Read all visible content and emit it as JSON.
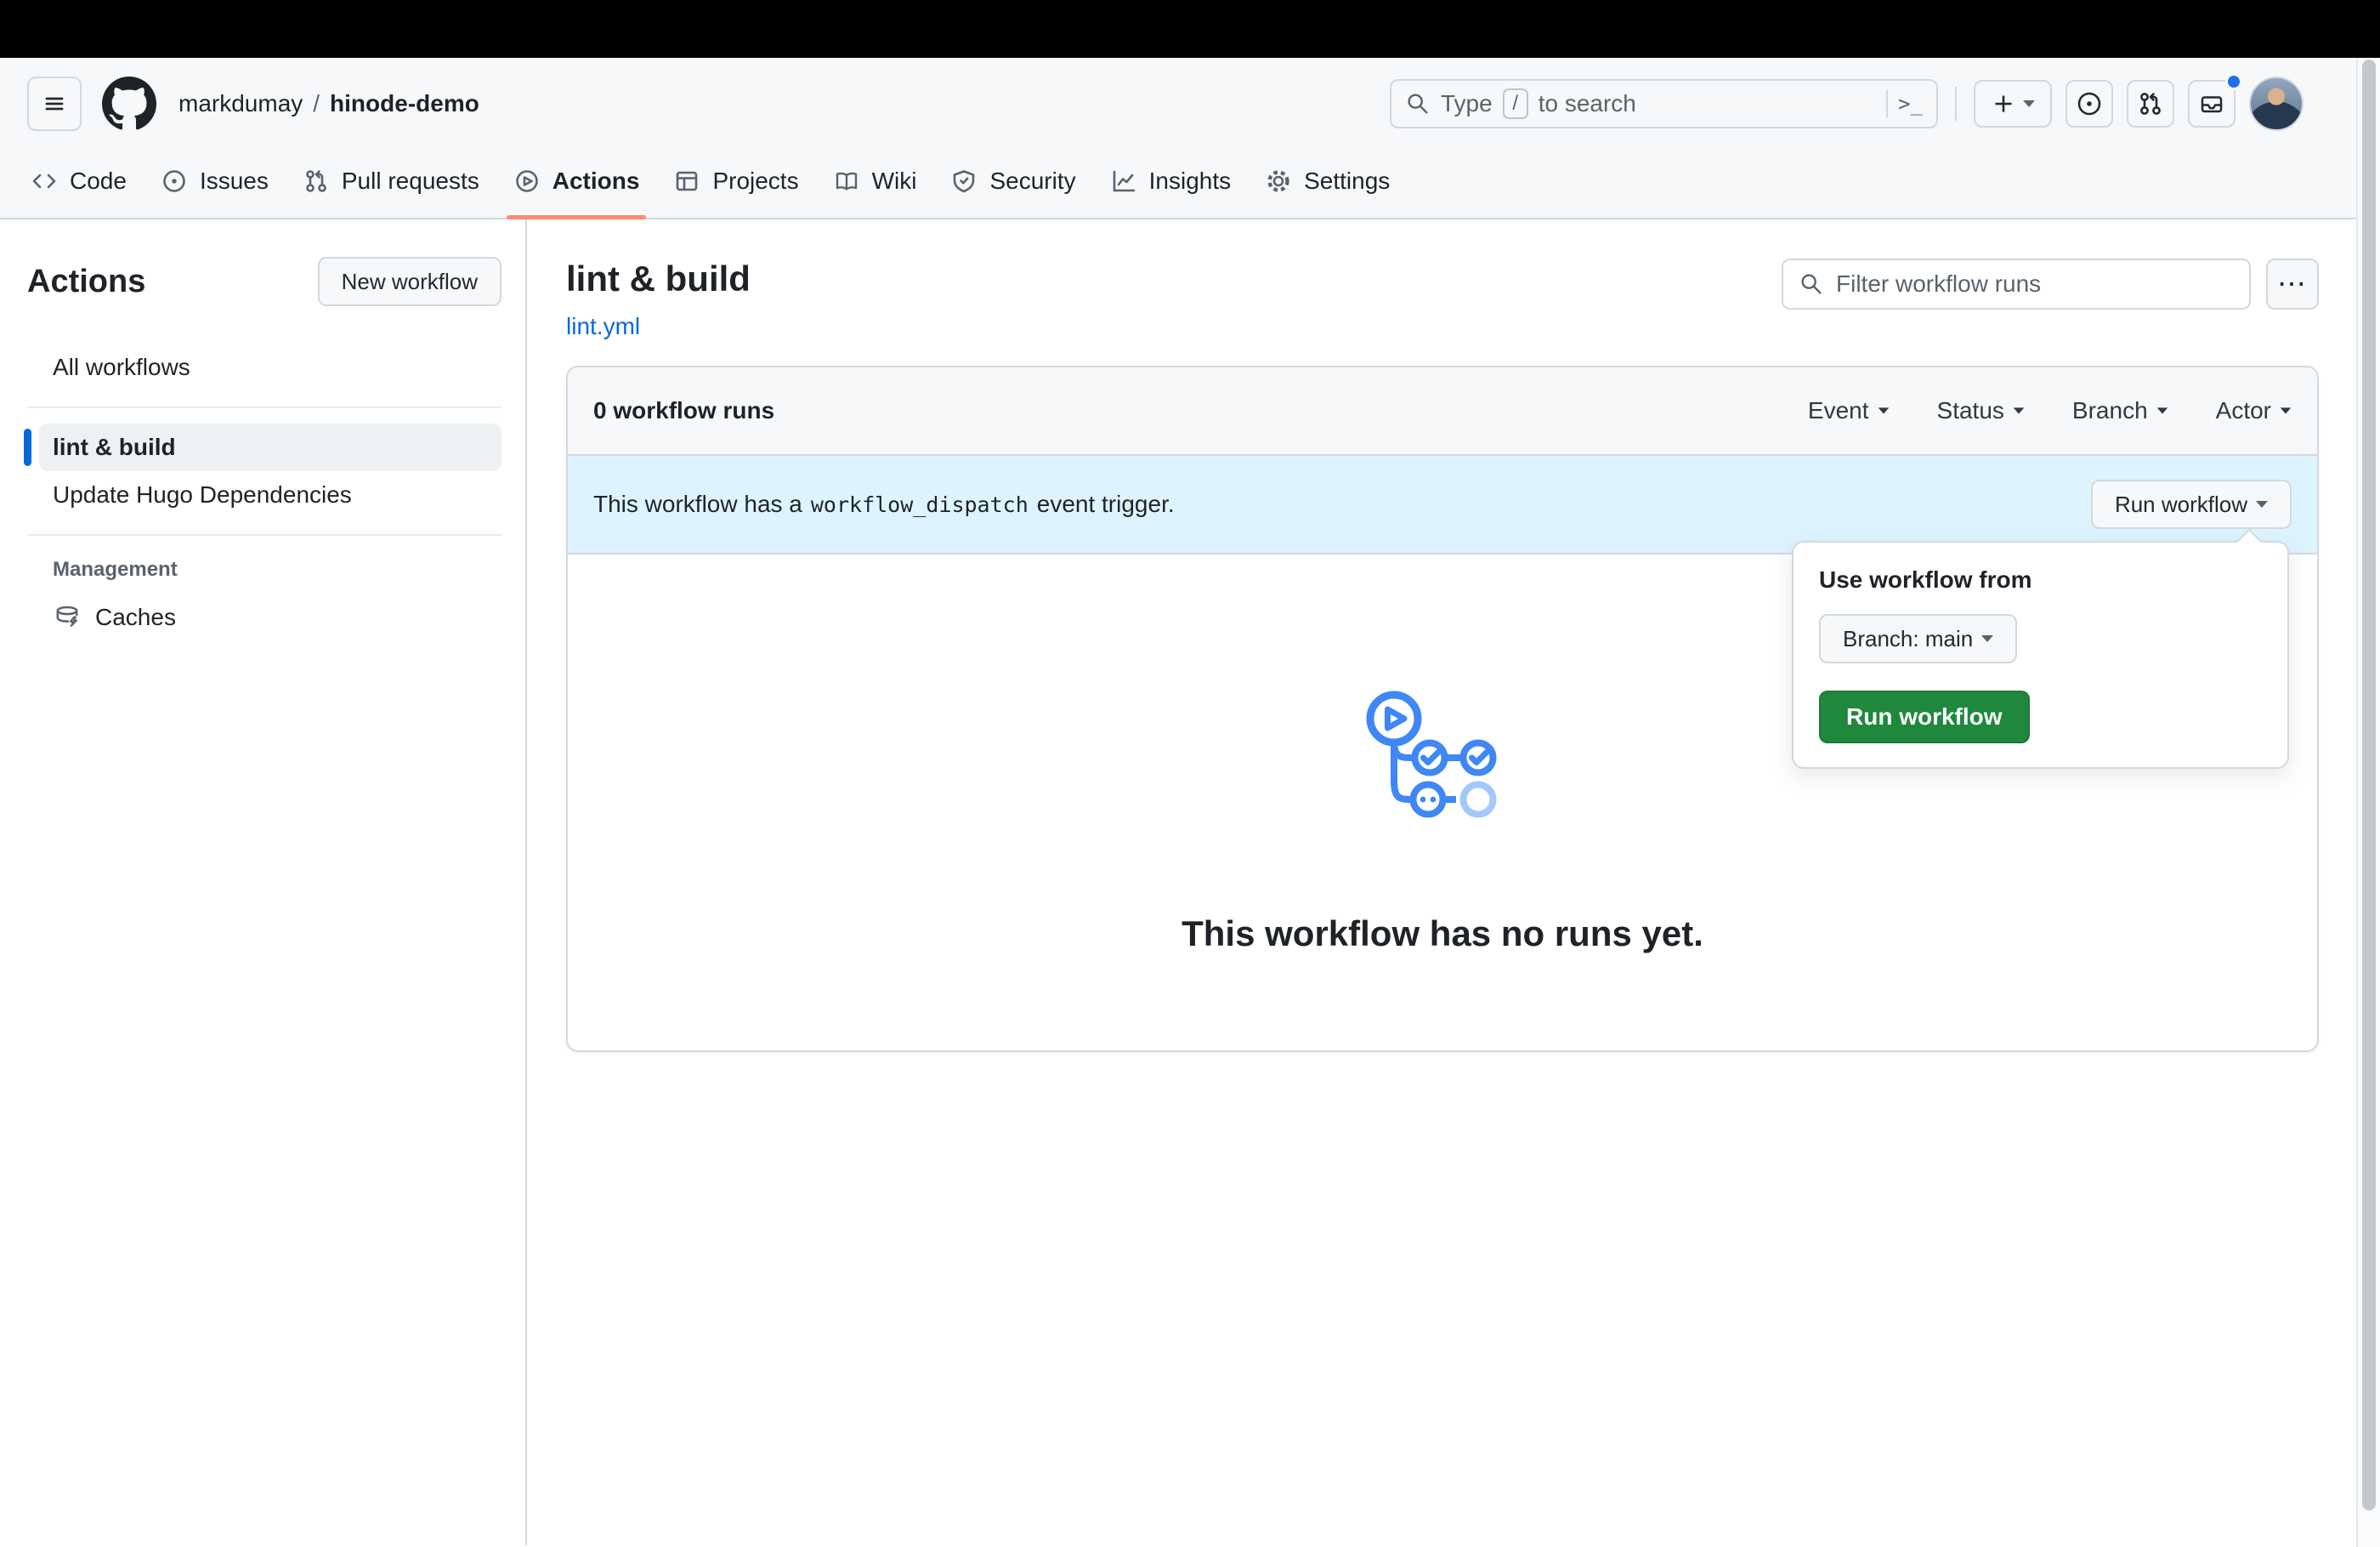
{
  "header": {
    "breadcrumb": {
      "owner": "markdumay",
      "separator": "/",
      "repo": "hinode-demo"
    },
    "search": {
      "prefix": "Type",
      "slash_key": "/",
      "suffix": "to search",
      "command_palette_glyph": ">_"
    },
    "notification_dot_color": "#1f6feb"
  },
  "nav": {
    "active_underline_color": "#fd8c73",
    "tabs": [
      {
        "label": "Code",
        "icon": "code-icon",
        "active": false
      },
      {
        "label": "Issues",
        "icon": "issue-opened-icon",
        "active": false
      },
      {
        "label": "Pull requests",
        "icon": "git-pull-request-icon",
        "active": false
      },
      {
        "label": "Actions",
        "icon": "play-circle-icon",
        "active": true
      },
      {
        "label": "Projects",
        "icon": "table-icon",
        "active": false
      },
      {
        "label": "Wiki",
        "icon": "book-icon",
        "active": false
      },
      {
        "label": "Security",
        "icon": "shield-icon",
        "active": false
      },
      {
        "label": "Insights",
        "icon": "graph-icon",
        "active": false
      },
      {
        "label": "Settings",
        "icon": "gear-icon",
        "active": false
      }
    ]
  },
  "sidebar": {
    "title": "Actions",
    "new_workflow_button": "New workflow",
    "selected_accent_color": "#0969da",
    "items": [
      {
        "label": "All workflows",
        "selected": false
      },
      {
        "label": "lint & build",
        "selected": true
      },
      {
        "label": "Update Hugo Dependencies",
        "selected": false
      }
    ],
    "management": {
      "heading": "Management",
      "items": [
        {
          "label": "Caches",
          "icon": "cache-database-icon"
        }
      ]
    }
  },
  "main": {
    "workflow_title": "lint & build",
    "workflow_file": "lint.yml",
    "filter_placeholder": "Filter workflow runs",
    "kebab_glyph": "⋯",
    "runs_panel": {
      "count_label": "0 workflow runs",
      "filters": [
        {
          "label": "Event"
        },
        {
          "label": "Status"
        },
        {
          "label": "Branch"
        },
        {
          "label": "Actor"
        }
      ],
      "banner": {
        "background": "#ddf4ff",
        "text_before_code": "This workflow has a",
        "code": "workflow_dispatch",
        "text_after_code": "event trigger.",
        "run_workflow_button": "Run workflow"
      },
      "empty_state": {
        "illustration": "workflow-graph-illustration",
        "illustration_blue": "#3f87f5",
        "illustration_faded_blue": "#a5c8fa",
        "message": "This workflow has no runs yet."
      }
    },
    "run_dropdown": {
      "heading": "Use workflow from",
      "branch_button": "Branch: main",
      "run_button": "Run workflow",
      "run_button_color": "#1f883d"
    }
  },
  "colors": {
    "accent": "#0969da",
    "text": "#1f2328",
    "muted": "#59636e",
    "border": "#d1d9e0",
    "canvas_subtle": "#f6f8fa"
  }
}
